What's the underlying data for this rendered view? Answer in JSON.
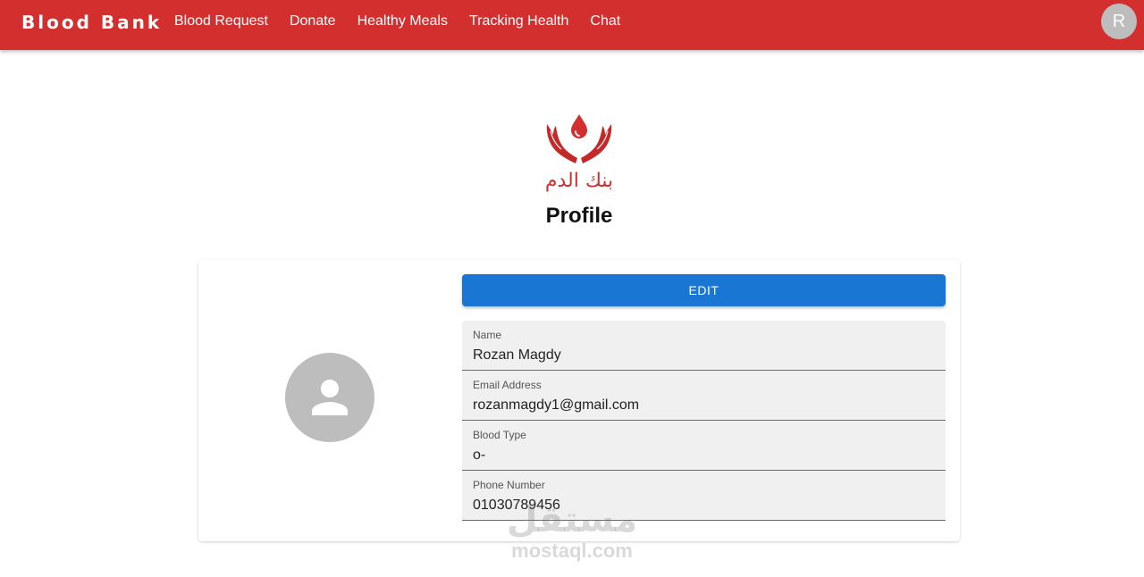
{
  "appbar": {
    "brand": "Blood Bank",
    "nav": [
      "Blood Request",
      "Donate",
      "Healthy Meals",
      "Tracking Health",
      "Chat"
    ],
    "avatar_letter": "R",
    "color": "#d32f2f"
  },
  "logo": {
    "text": "بنك الدم",
    "icon": "blood-drop-hands-icon"
  },
  "page": {
    "title": "Profile"
  },
  "profile": {
    "edit_label": "EDIT",
    "avatar_icon": "person-icon",
    "fields": [
      {
        "label": "Name",
        "value": "Rozan Magdy"
      },
      {
        "label": "Email Address",
        "value": "rozanmagdy1@gmail.com"
      },
      {
        "label": "Blood Type",
        "value": "o-"
      },
      {
        "label": "Phone Number",
        "value": "01030789456"
      }
    ]
  },
  "watermark": {
    "arabic": "مستقل",
    "latin": "mostaql.com"
  }
}
